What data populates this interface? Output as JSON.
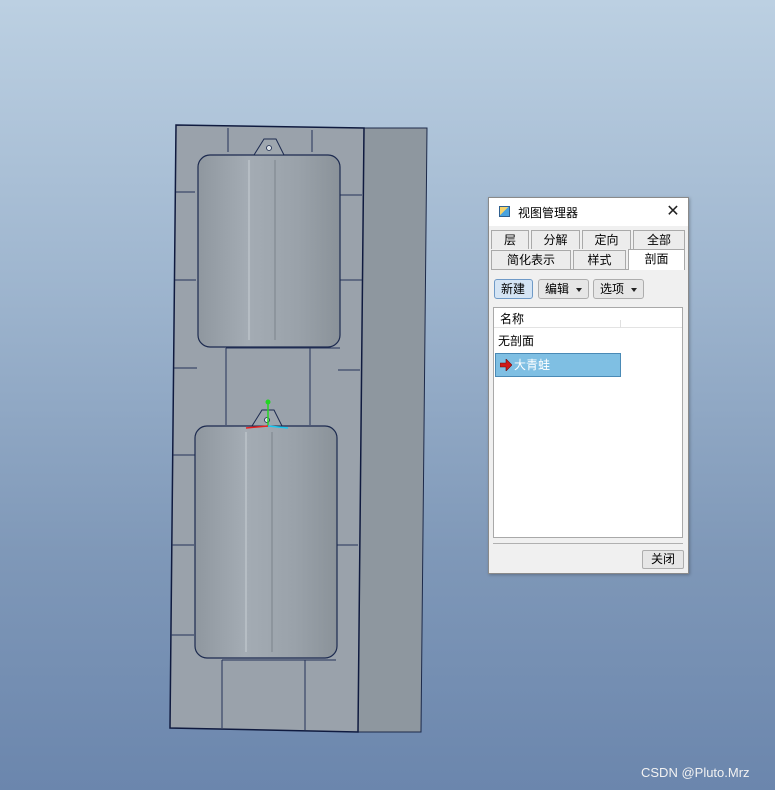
{
  "dialog": {
    "title": "视图管理器",
    "close_glyph": "✕",
    "tabs_row1": [
      "层",
      "分解",
      "定向",
      "全部"
    ],
    "tabs_row2": [
      "简化表示",
      "样式",
      "剖面"
    ],
    "active_tab": "剖面",
    "toolbar": {
      "new_label": "新建",
      "edit_label": "编辑",
      "options_label": "选项"
    },
    "list": {
      "header": "名称",
      "items": [
        "无剖面",
        "大青蛙"
      ],
      "selected": "大青蛙"
    },
    "close_button": "关闭"
  },
  "icons": [
    "view-manager-icon",
    "close-icon",
    "dropdown-caret-icon",
    "active-section-arrow-icon",
    "coordinate-axes-icon"
  ],
  "colors": {
    "background_top": "#bcd0e2",
    "background_bottom": "#6b86ad",
    "model_gray": "#9ba3ac",
    "selection": "#7fbfe3",
    "arrow_red": "#d01818"
  },
  "watermark": "CSDN @Pluto.Mrz"
}
